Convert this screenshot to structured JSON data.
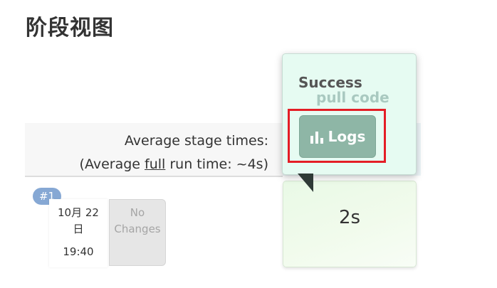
{
  "page": {
    "title": "阶段视图"
  },
  "header": {
    "avg_stage_times_label": "Average stage times:",
    "avg_run_prefix": "(Average ",
    "avg_run_link": "full",
    "avg_run_suffix": " run time: ~4s)"
  },
  "build": {
    "number": "#1",
    "date": "10月 22 日",
    "time": "19:40",
    "changes_label": "No Changes"
  },
  "stage": {
    "avg_time": "2s",
    "duration": "2s"
  },
  "popover": {
    "status": "Success",
    "stage_name": "pull code",
    "logs_button": "Logs",
    "logs_icon": "bar-chart-icon"
  },
  "colors": {
    "success_bg": "#e6fbf2",
    "logs_button_bg": "#8eb6a6",
    "build_badge_bg": "#86a8d4",
    "highlight": "#e41e26"
  }
}
